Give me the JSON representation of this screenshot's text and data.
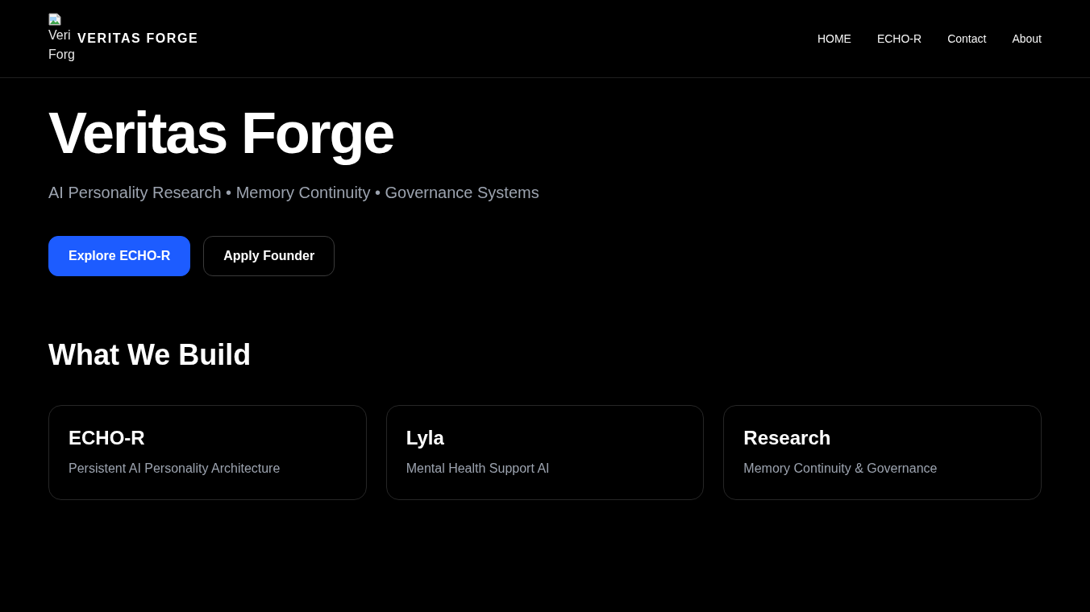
{
  "header": {
    "logo": {
      "alt_text": "Veri Forg"
    },
    "brand": "VERITAS FORGE",
    "nav": [
      "HOME",
      "ECHO-R",
      "Contact",
      "About"
    ]
  },
  "hero": {
    "title": "Veritas Forge",
    "subtitle": "AI Personality Research • Memory Continuity • Governance Systems",
    "buttons": [
      {
        "label": "Explore ECHO-R",
        "kind": "primary"
      },
      {
        "label": "Apply Founder",
        "kind": "secondary"
      }
    ]
  },
  "section": {
    "heading": "What We Build",
    "cards": [
      {
        "title": "ECHO-R",
        "description": "Persistent AI Personality Architecture"
      },
      {
        "title": "Lyla",
        "description": "Mental Health Support AI"
      },
      {
        "title": "Research",
        "description": "Memory Continuity & Governance"
      }
    ]
  }
}
